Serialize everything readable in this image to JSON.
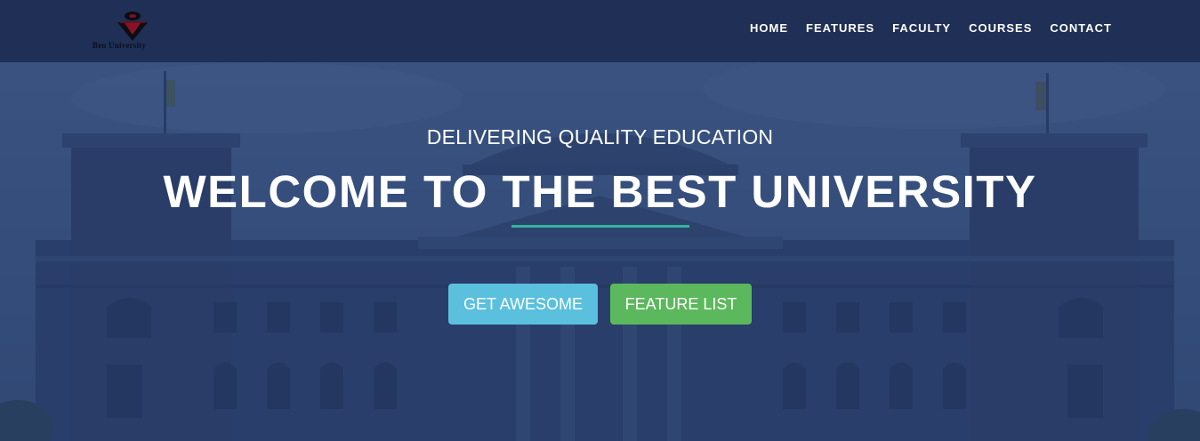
{
  "brand": {
    "logo_text": "Ben University",
    "colors": {
      "header": "#1f2f55",
      "accent_line": "#34b3a0"
    }
  },
  "nav": {
    "items": [
      {
        "label": "HOME"
      },
      {
        "label": "FEATURES"
      },
      {
        "label": "FACULTY"
      },
      {
        "label": "COURSES"
      },
      {
        "label": "CONTACT"
      }
    ]
  },
  "hero": {
    "subtitle": "DELIVERING QUALITY EDUCATION",
    "title": "WELCOME TO THE BEST UNIVERSITY",
    "background_image": "parliament-building-photo",
    "buttons": {
      "primary": {
        "label": "GET AWESOME",
        "color": "#5bc0de"
      },
      "secondary": {
        "label": "FEATURE LIST",
        "color": "#5cb85c"
      }
    }
  }
}
